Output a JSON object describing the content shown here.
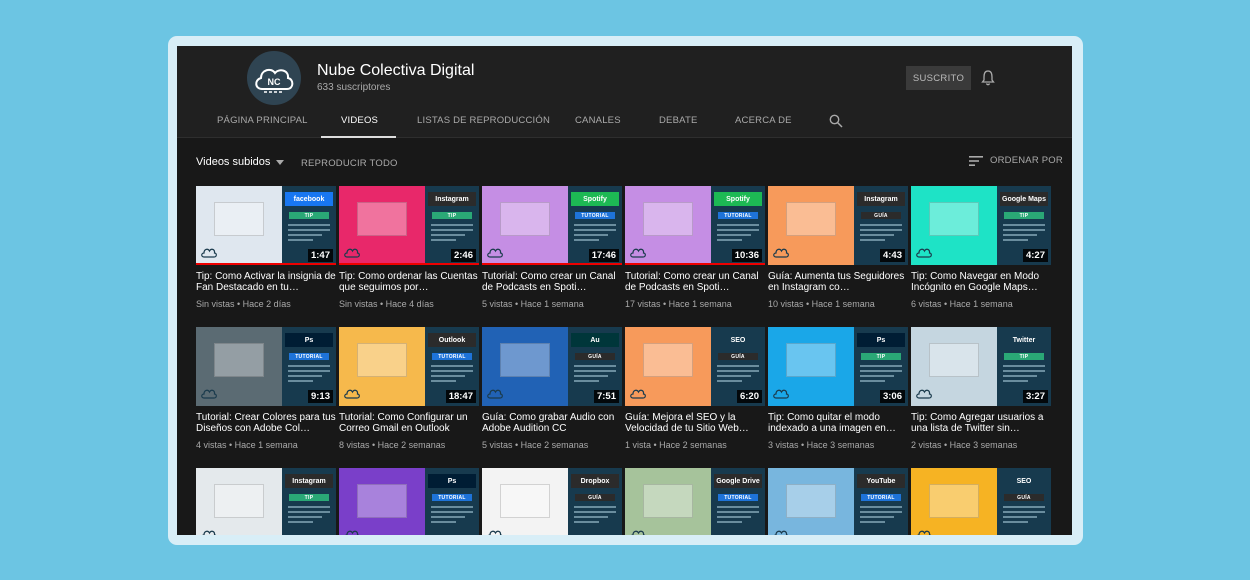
{
  "channel": {
    "name": "Nube Colectiva Digital",
    "subscribers": "633 suscriptores",
    "avatar_text": "NC",
    "subscribe_label": "SUSCRITO"
  },
  "tabs": [
    {
      "label": "PÁGINA PRINCIPAL",
      "active": false
    },
    {
      "label": "VIDEOS",
      "active": true
    },
    {
      "label": "LISTAS DE REPRODUCCIÓN",
      "active": false
    },
    {
      "label": "CANALES",
      "active": false
    },
    {
      "label": "DEBATE",
      "active": false
    },
    {
      "label": "ACERCA DE",
      "active": false
    }
  ],
  "toolbar": {
    "filter_label": "Videos subidos",
    "play_all_label": "REPRODUCIR TODO",
    "sort_label": "ORDENAR POR"
  },
  "icons": {
    "bell": "bell-icon",
    "search": "search-icon",
    "dropdown": "caret-down-icon",
    "sort": "sort-lines-icon"
  },
  "videos": [
    {
      "title": "Tip: Como Activar la insignia de Fan Destacado en tu…",
      "meta": "Sin vistas • Hace 2 días",
      "duration": "1:47",
      "brand": "facebook",
      "brand_color": "#1877f2",
      "tag": "TIP",
      "tag_color": "#2aa876",
      "bg": "#dfe7ef",
      "progress": 1.0
    },
    {
      "title": "Tip: Como ordenar las Cuentas que seguimos por…",
      "meta": "Sin vistas • Hace 4 días",
      "duration": "2:46",
      "brand": "Instagram",
      "brand_color": "#2b2b2b",
      "tag": "TIP",
      "tag_color": "#2aa876",
      "bg": "#e8286a",
      "progress": 1.0
    },
    {
      "title": "Tutorial: Como crear un Canal de Podcasts en Spoti…",
      "meta": "5 vistas • Hace 1 semana",
      "duration": "17:46",
      "brand": "Spotify",
      "brand_color": "#1db954",
      "tag": "TUTORIAL",
      "tag_color": "#1e73d8",
      "bg": "#c58ee4",
      "progress": 1.0
    },
    {
      "title": "Tutorial: Como crear un Canal de Podcasts en Spoti…",
      "meta": "17 vistas • Hace 1 semana",
      "duration": "10:36",
      "brand": "Spotify",
      "brand_color": "#1db954",
      "tag": "TUTORIAL",
      "tag_color": "#1e73d8",
      "bg": "#c58ee4",
      "progress": 1.0
    },
    {
      "title": "Guía: Aumenta tus Seguidores en Instagram co…",
      "meta": "10 vistas • Hace 1 semana",
      "duration": "4:43",
      "brand": "Instagram",
      "brand_color": "#2b2b2b",
      "tag": "GUÍA",
      "tag_color": "#2b2b2b",
      "bg": "#f79a5b",
      "progress": 0.0
    },
    {
      "title": "Tip: Como Navegar en Modo Incógnito en Google Maps…",
      "meta": "6 vistas • Hace 1 semana",
      "duration": "4:27",
      "brand": "Google Maps",
      "brand_color": "#2b2b2b",
      "tag": "TIP",
      "tag_color": "#2aa876",
      "bg": "#1ee3c6",
      "progress": 0.0
    },
    {
      "title": "Tutorial: Crear Colores para tus Diseños con Adobe Col…",
      "meta": "4 vistas • Hace 1 semana",
      "duration": "9:13",
      "brand": "Ps",
      "brand_color": "#001d34",
      "tag": "TUTORIAL",
      "tag_color": "#1e73d8",
      "bg": "#5b6b73",
      "progress": 0.0
    },
    {
      "title": "Tutorial: Como Configurar un Correo Gmail en Outlook",
      "meta": "8 vistas • Hace 2 semanas",
      "duration": "18:47",
      "brand": "Outlook",
      "brand_color": "#2b2b2b",
      "tag": "TUTORIAL",
      "tag_color": "#1e73d8",
      "bg": "#f6b94c",
      "progress": 0.0
    },
    {
      "title": "Guía: Como grabar Audio con Adobe Audition CC",
      "meta": "5 vistas • Hace 2 semanas",
      "duration": "7:51",
      "brand": "Au",
      "brand_color": "#00363a",
      "tag": "GUÍA",
      "tag_color": "#2b2b2b",
      "bg": "#2162b5",
      "progress": 0.0
    },
    {
      "title": "Guía: Mejora el SEO y la Velocidad de tu Sitio Web…",
      "meta": "1 vista • Hace 2 semanas",
      "duration": "6:20",
      "brand": "SEO",
      "brand_color": "#173a4e",
      "tag": "GUÍA",
      "tag_color": "#2b2b2b",
      "bg": "#f79a5b",
      "progress": 0.0
    },
    {
      "title": "Tip: Como quitar el modo indexado a una imagen en…",
      "meta": "3 vistas • Hace 3 semanas",
      "duration": "3:06",
      "brand": "Ps",
      "brand_color": "#001d34",
      "tag": "TIP",
      "tag_color": "#2aa876",
      "bg": "#1aa7e8",
      "progress": 0.0
    },
    {
      "title": "Tip: Como Agregar usuarios a una lista de Twitter sin…",
      "meta": "2 vistas • Hace 3 semanas",
      "duration": "3:27",
      "brand": "Twitter",
      "brand_color": "#173a4e",
      "tag": "TIP",
      "tag_color": "#2aa876",
      "bg": "#c5d6e0",
      "progress": 0.0
    },
    {
      "title": "",
      "meta": "",
      "duration": "",
      "brand": "Instagram",
      "brand_color": "#2b2b2b",
      "tag": "TIP",
      "tag_color": "#2aa876",
      "bg": "#e4e9ec",
      "progress": 0.0
    },
    {
      "title": "",
      "meta": "",
      "duration": "",
      "brand": "Ps",
      "brand_color": "#001d34",
      "tag": "TUTORIAL",
      "tag_color": "#1e73d8",
      "bg": "#7a3fc9",
      "progress": 0.0
    },
    {
      "title": "",
      "meta": "",
      "duration": "",
      "brand": "Dropbox",
      "brand_color": "#2b2b2b",
      "tag": "GUÍA",
      "tag_color": "#2b2b2b",
      "bg": "#f3f3f3",
      "progress": 0.0
    },
    {
      "title": "",
      "meta": "",
      "duration": "",
      "brand": "Google Drive",
      "brand_color": "#2b2b2b",
      "tag": "TUTORIAL",
      "tag_color": "#1e73d8",
      "bg": "#a6c39b",
      "progress": 0.0
    },
    {
      "title": "",
      "meta": "",
      "duration": "",
      "brand": "YouTube",
      "brand_color": "#2b2b2b",
      "tag": "TUTORIAL",
      "tag_color": "#1e73d8",
      "bg": "#78b6de",
      "progress": 0.0
    },
    {
      "title": "",
      "meta": "",
      "duration": "",
      "brand": "SEO",
      "brand_color": "#173a4e",
      "tag": "GUÍA",
      "tag_color": "#2b2b2b",
      "bg": "#f6b323",
      "progress": 0.0
    }
  ]
}
